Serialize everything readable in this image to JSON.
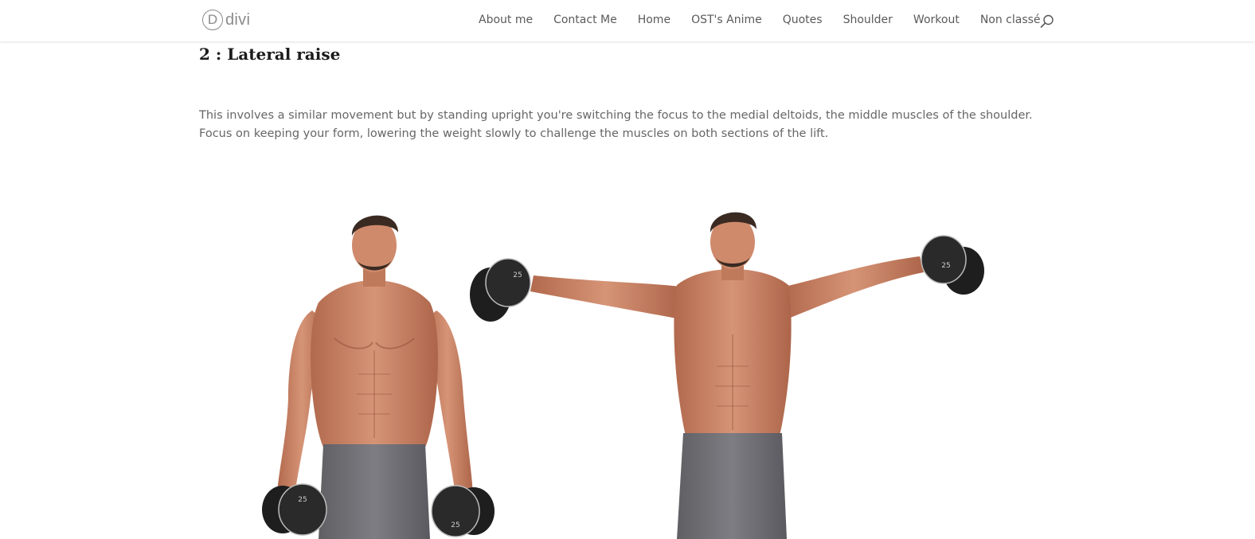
{
  "header": {
    "logo": {
      "mark": "D",
      "text": "divi"
    },
    "nav": [
      {
        "label": "About me"
      },
      {
        "label": "Contact Me"
      },
      {
        "label": "Home"
      },
      {
        "label": "OST's Anime"
      },
      {
        "label": "Quotes"
      },
      {
        "label": "Shoulder"
      },
      {
        "label": "Workout"
      },
      {
        "label": "Non classé"
      }
    ],
    "search_icon": "search-icon"
  },
  "article": {
    "heading": "2 : Lateral raise",
    "paragraph": "This involves a similar movement but by standing upright you're switching the focus to the medial deltoids, the middle muscles of the shoulder. Focus on keeping your form, lowering the weight slowly to challenge the muscles on both sections of the lift."
  },
  "figure": {
    "dumbbell_labels": [
      "25",
      "25",
      "25",
      "25"
    ]
  },
  "colors": {
    "nav_text": "#5a5a5a",
    "body_text": "#666666",
    "heading_text": "#1b1b1b",
    "skin": "#c98567",
    "shorts": "#6e6e73",
    "dumbbell": "#222222"
  }
}
